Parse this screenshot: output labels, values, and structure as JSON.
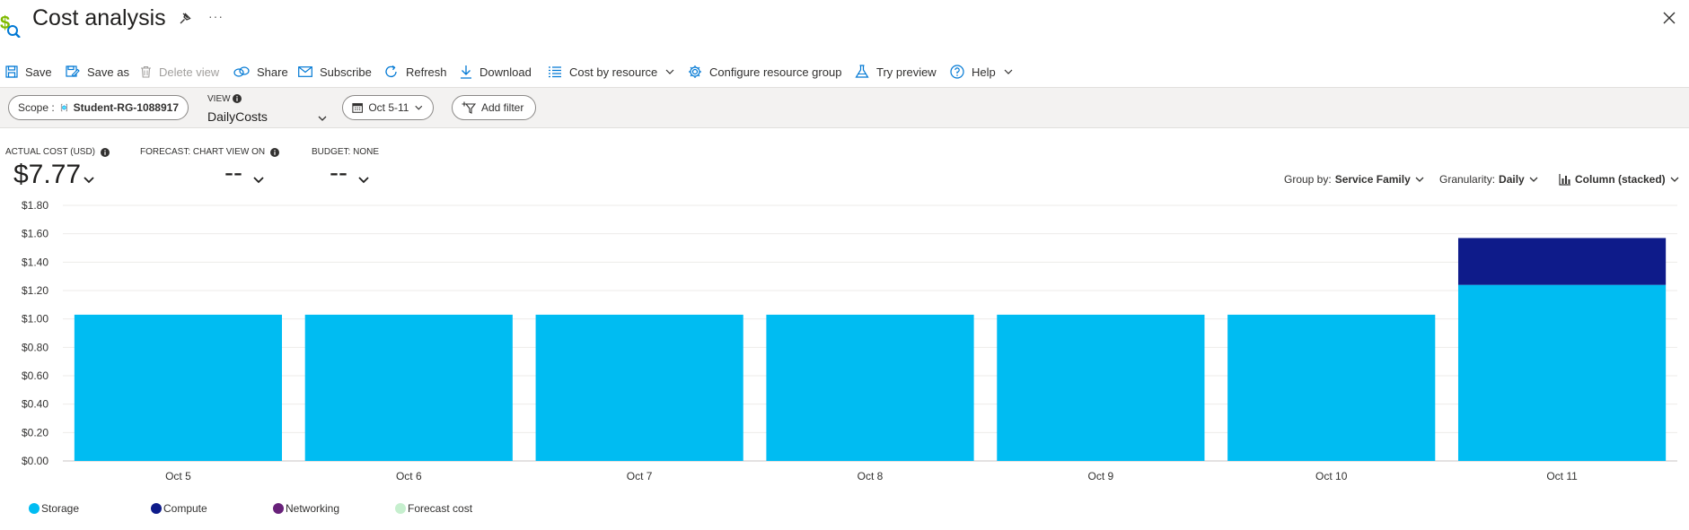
{
  "header": {
    "title": "Cost analysis",
    "more": "···"
  },
  "toolbar": {
    "save": "Save",
    "save_as": "Save as",
    "delete_view": "Delete view",
    "share": "Share",
    "subscribe": "Subscribe",
    "refresh": "Refresh",
    "download": "Download",
    "cost_by_resource": "Cost by resource",
    "configure_resource_group": "Configure resource group",
    "try_preview": "Try preview",
    "help": "Help"
  },
  "filters": {
    "scope_label": "Scope :",
    "scope_value": "Student-RG-1088917",
    "view_label": "VIEW",
    "view_value": "DailyCosts",
    "date_range": "Oct 5-11",
    "add_filter": "Add filter"
  },
  "kpis": {
    "actual_cost_label": "ACTUAL COST (USD)",
    "actual_cost_value": "$7.77",
    "forecast_label": "FORECAST: CHART VIEW ON",
    "forecast_value": "--",
    "budget_label": "BUDGET: NONE",
    "budget_value": "--"
  },
  "chart_controls": {
    "group_by_label": "Group by:",
    "group_by_value": "Service Family",
    "granularity_label": "Granularity:",
    "granularity_value": "Daily",
    "chart_type": "Column (stacked)"
  },
  "colors": {
    "storage": "#00bcf2",
    "compute": "#0e1b8a",
    "networking": "#68217a",
    "forecast": "#c6efce",
    "accent": "#0078d4"
  },
  "chart_data": {
    "type": "bar",
    "stacked": true,
    "categories": [
      "Oct 5",
      "Oct 6",
      "Oct 7",
      "Oct 8",
      "Oct 9",
      "Oct 10",
      "Oct 11"
    ],
    "series": [
      {
        "name": "Storage",
        "values": [
          1.03,
          1.03,
          1.03,
          1.03,
          1.03,
          1.03,
          1.24
        ]
      },
      {
        "name": "Compute",
        "values": [
          0,
          0,
          0,
          0,
          0,
          0,
          0.33
        ]
      }
    ],
    "ylim": [
      0,
      1.8
    ],
    "yticks": [
      "$0.00",
      "$0.20",
      "$0.40",
      "$0.60",
      "$0.80",
      "$1.00",
      "$1.20",
      "$1.40",
      "$1.60",
      "$1.80"
    ],
    "grid": true,
    "legend": [
      "Storage",
      "Compute",
      "Networking",
      "Forecast cost"
    ],
    "legend_position": "bottom-left"
  }
}
